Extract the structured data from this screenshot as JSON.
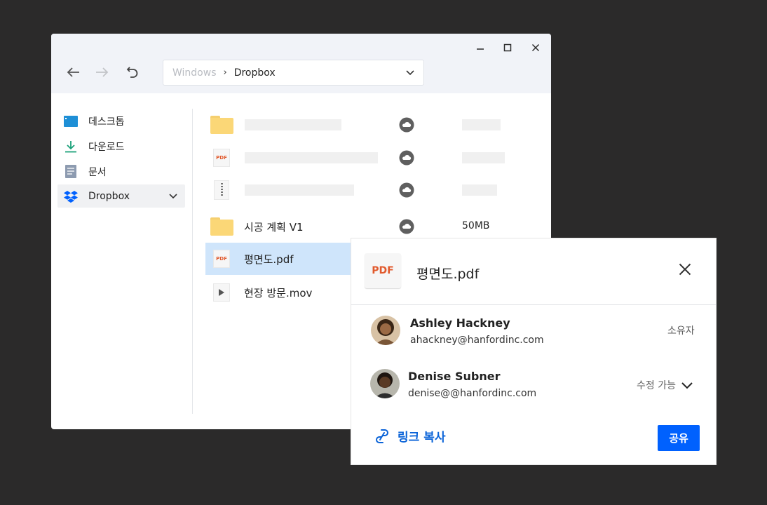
{
  "window": {
    "controls": {
      "minimize": "—",
      "maximize": "☐",
      "close": "✕"
    },
    "address": {
      "root": "Windows",
      "separator": "›",
      "current": "Dropbox"
    }
  },
  "sidebar": {
    "items": [
      {
        "label": "데스크톱",
        "icon": "desktop-icon"
      },
      {
        "label": "다운로드",
        "icon": "download-icon"
      },
      {
        "label": "문서",
        "icon": "document-icon"
      },
      {
        "label": "Dropbox",
        "icon": "dropbox-icon"
      }
    ]
  },
  "files": [
    {
      "name": "",
      "type": "folder",
      "size": ""
    },
    {
      "name": "",
      "type": "pdf",
      "size": ""
    },
    {
      "name": "",
      "type": "zip",
      "size": ""
    },
    {
      "name": "시공 계획 V1",
      "type": "folder",
      "size": "50MB"
    },
    {
      "name": "평면도.pdf",
      "type": "pdf",
      "size": ""
    },
    {
      "name": "현장 방문.mov",
      "type": "video",
      "size": ""
    }
  ],
  "file_icon_text": {
    "pdf": "PDF"
  },
  "share_panel": {
    "file_badge": "PDF",
    "file_name": "평면도.pdf",
    "users": [
      {
        "name": "Ashley Hackney",
        "email": "ahackney@hanfordinc.com",
        "role": "소유자"
      },
      {
        "name": "Denise Subner",
        "email": "denise@@hanfordinc.com",
        "role": "수정 가능"
      }
    ],
    "copy_link": "링크 복사",
    "share": "공유"
  },
  "colors": {
    "accent": "#0061fe",
    "link": "#0a63d8",
    "selection": "#cfe5fb",
    "folder": "#fbd777",
    "pdf": "#e15a2d"
  }
}
